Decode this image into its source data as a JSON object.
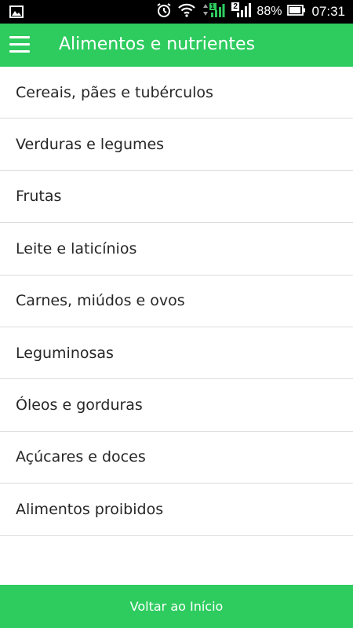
{
  "status_bar": {
    "battery": "88%",
    "time": "07:31",
    "sim1_badge": "1",
    "sim2_badge": "2",
    "icons": [
      "image-icon",
      "alarm-icon",
      "wifi-icon",
      "signal-icon",
      "signal-icon",
      "battery-icon"
    ]
  },
  "app_bar": {
    "title": "Alimentos e nutrientes",
    "color": "#2ECC5F"
  },
  "list": {
    "items": [
      {
        "label": "Cereais, pães e tubérculos"
      },
      {
        "label": "Verduras e legumes"
      },
      {
        "label": "Frutas"
      },
      {
        "label": "Leite e laticínios"
      },
      {
        "label": "Carnes, miúdos e ovos"
      },
      {
        "label": "Leguminosas"
      },
      {
        "label": "Óleos e gorduras"
      },
      {
        "label": "Açúcares e doces"
      },
      {
        "label": "Alimentos proibidos"
      }
    ]
  },
  "footer": {
    "button_label": "Voltar ao Início"
  }
}
